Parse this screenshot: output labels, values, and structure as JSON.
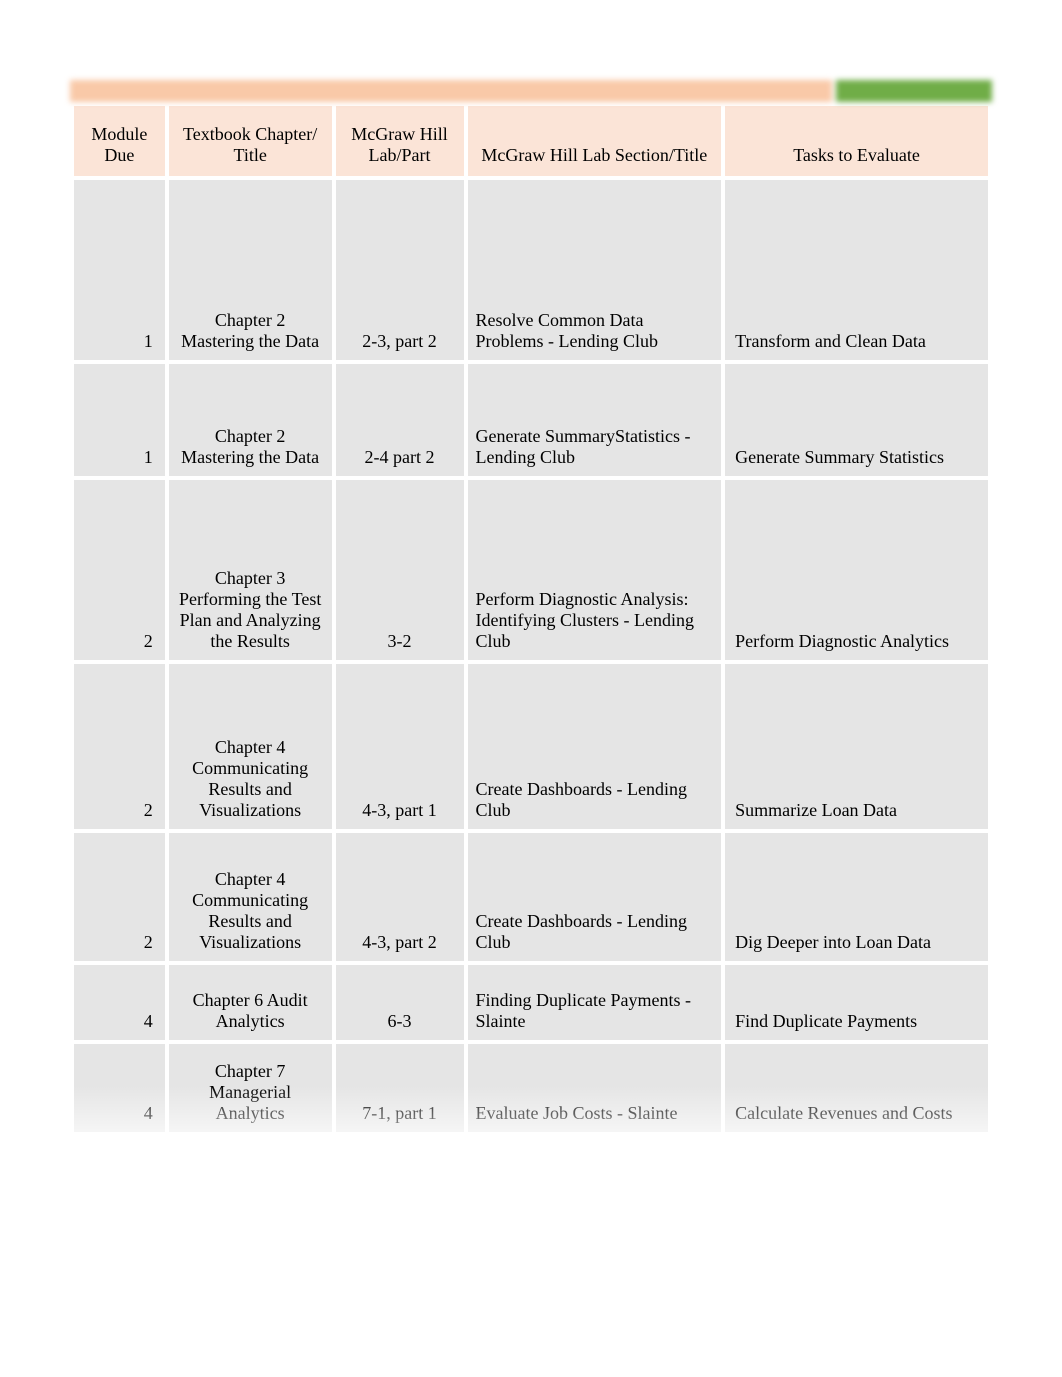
{
  "headers": {
    "module": "Module Due",
    "chapter": "Textbook Chapter/ Title",
    "lab": "McGraw Hill Lab/Part",
    "section": "McGraw Hill Lab Section/Title",
    "tasks": "Tasks to Evaluate"
  },
  "rows": [
    {
      "module": "1",
      "chapter": "Chapter 2 Mastering the Data",
      "lab": "2-3, part 2",
      "section": "Resolve Common Data Problems - Lending Club",
      "tasks": "Transform and Clean  Data"
    },
    {
      "module": "1",
      "chapter": "Chapter 2 Mastering the Data",
      "lab": "2-4 part 2",
      "section": "Generate SummaryStatistics - Lending Club",
      "tasks": "Generate Summary Statistics"
    },
    {
      "module": "2",
      "chapter": "Chapter 3 Performing the Test Plan and Analyzing the Results",
      "lab": "3-2",
      "section": "Perform Diagnostic Analysis: Identifying Clusters - Lending Club",
      "tasks": "Perform Diagnostic Analytics"
    },
    {
      "module": "2",
      "chapter": "Chapter 4 Communicating Results and Visualizations",
      "lab": "4-3, part 1",
      "section": "Create Dashboards - Lending Club",
      "tasks": "Summarize Loan Data"
    },
    {
      "module": "2",
      "chapter": "Chapter 4 Communicating Results and Visualizations",
      "lab": "4-3, part 2",
      "section": "Create Dashboards - Lending Club",
      "tasks": "Dig Deeper into Loan Data"
    },
    {
      "module": "4",
      "chapter": "Chapter 6 Audit Analytics",
      "lab": "6-3",
      "section": "Finding Duplicate Payments - Slainte",
      "tasks": "Find Duplicate Payments"
    },
    {
      "module": "4",
      "chapter": "Chapter 7 Managerial Analytics",
      "lab": "7-1, part 1",
      "section": "Evaluate Job Costs - Slainte",
      "tasks": "Calculate Revenues and Costs"
    }
  ]
}
